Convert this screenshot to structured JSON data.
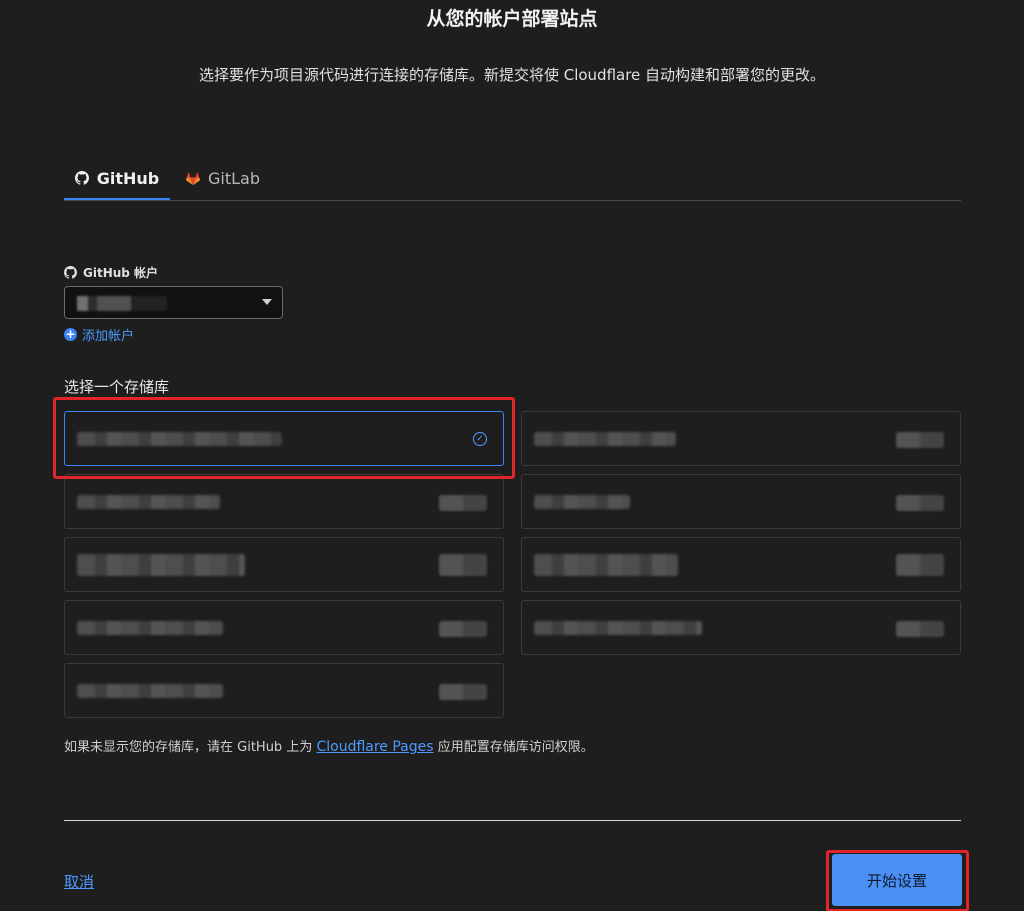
{
  "header": {
    "title": "从您的帐户部署站点",
    "subtitle": "选择要作为项目源代码进行连接的存储库。新提交将使 Cloudflare 自动构建和部署您的更改。"
  },
  "tabs": [
    {
      "label": "GitHub",
      "icon": "github-icon",
      "active": true
    },
    {
      "label": "GitLab",
      "icon": "gitlab-icon",
      "active": false
    }
  ],
  "account": {
    "label": "GitHub 帐户",
    "selected_value": "",
    "add_label": "添加帐户"
  },
  "repos": {
    "heading": "选择一个存储库",
    "items": [
      {
        "name": "",
        "selected": true
      },
      {
        "name": "",
        "selected": false
      },
      {
        "name": "",
        "selected": false
      },
      {
        "name": "",
        "selected": false
      },
      {
        "name": "",
        "selected": false
      },
      {
        "name": "",
        "selected": false
      },
      {
        "name": "",
        "selected": false
      },
      {
        "name": "",
        "selected": false
      },
      {
        "name": "",
        "selected": false
      }
    ]
  },
  "notice": {
    "prefix": "如果未显示您的存储库，请在 GitHub 上为",
    "link": "Cloudflare Pages",
    "suffix": "应用配置存储库访问权限。"
  },
  "footer": {
    "cancel_label": "取消",
    "start_label": "开始设置"
  },
  "colors": {
    "accent": "#3b82f6",
    "highlight": "#e0262b",
    "background": "#1e1e1f"
  }
}
